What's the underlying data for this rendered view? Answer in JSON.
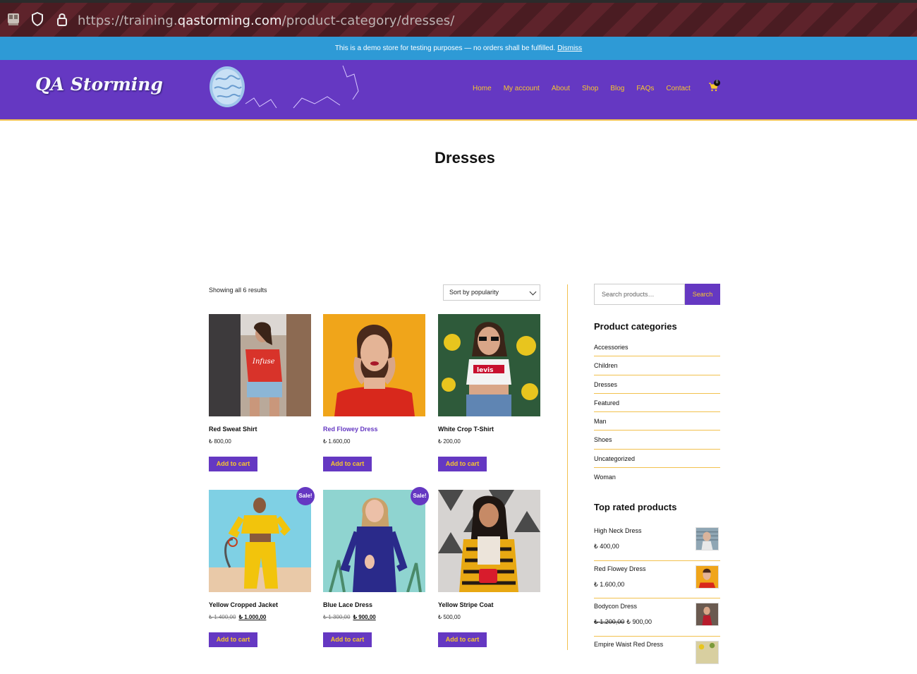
{
  "browser": {
    "url_prefix": "https://training.",
    "url_domain": "qastorming.com",
    "url_path": "/product-category/dresses/"
  },
  "notice": {
    "text": "This is a demo store for testing purposes — no orders shall be fulfilled.",
    "dismiss": "Dismiss"
  },
  "header": {
    "logo_text": "QA Storming",
    "nav": [
      "Home",
      "My account",
      "About",
      "Shop",
      "Blog",
      "FAQs",
      "Contact"
    ],
    "cart_count": "0"
  },
  "page": {
    "title": "Dresses",
    "result_count": "Showing all 6 results",
    "sort": "Sort by popularity"
  },
  "products": [
    {
      "name": "Red Sweat Shirt",
      "price": "₺ 800,00",
      "old_price": "",
      "button": "Add to cart",
      "sale": ""
    },
    {
      "name": "Red Flowey Dress",
      "price": "₺ 1.600,00",
      "old_price": "",
      "button": "Add to cart",
      "sale": ""
    },
    {
      "name": "White Crop T-Shirt",
      "price": "₺ 200,00",
      "old_price": "",
      "button": "Add to cart",
      "sale": ""
    },
    {
      "name": "Yellow Cropped Jacket",
      "price": "₺ 1.000,00",
      "old_price": "₺ 1.400,00",
      "button": "Add to cart",
      "sale": "Sale!"
    },
    {
      "name": "Blue Lace Dress",
      "price": "₺ 900,00",
      "old_price": "₺ 1.300,00",
      "button": "Add to cart",
      "sale": "Sale!"
    },
    {
      "name": "Yellow Stripe Coat",
      "price": "₺ 500,00",
      "old_price": "",
      "button": "Add to cart",
      "sale": ""
    }
  ],
  "sidebar": {
    "search_placeholder": "Search products…",
    "search_button": "Search",
    "categories_title": "Product categories",
    "categories": [
      "Accessories",
      "Children",
      "Dresses",
      "Featured",
      "Man",
      "Shoes",
      "Uncategorized",
      "Woman"
    ],
    "top_rated_title": "Top rated products",
    "top_rated": [
      {
        "name": "High Neck Dress",
        "price": "₺ 400,00",
        "old_price": ""
      },
      {
        "name": "Red Flowey Dress",
        "price": "₺ 1.600,00",
        "old_price": ""
      },
      {
        "name": "Bodycon Dress",
        "price": "₺ 900,00",
        "old_price": "₺ 1.200,00"
      },
      {
        "name": "Empire Waist Red Dress",
        "price": "",
        "old_price": ""
      }
    ]
  },
  "colors": {
    "header_purple": "#6538c2",
    "accent_yellow": "#f8c72c",
    "notice_blue": "#2e9ad6"
  }
}
